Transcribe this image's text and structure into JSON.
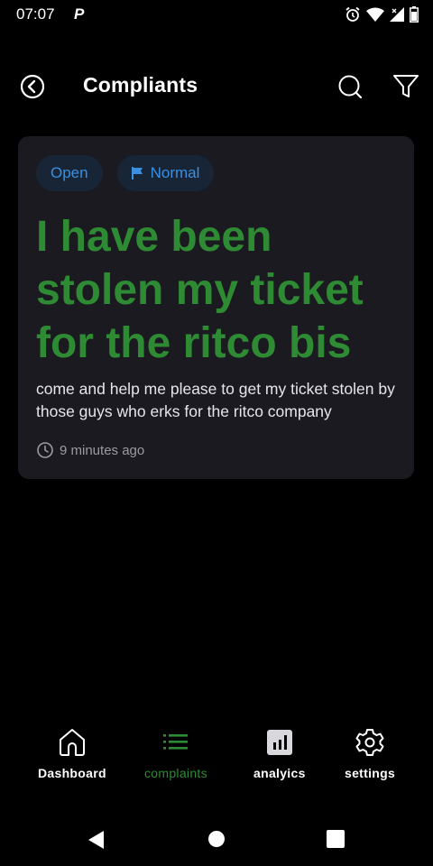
{
  "status_bar": {
    "time": "07:07",
    "app_indicator": "P",
    "icons": [
      "alarm-icon",
      "wifi-icon",
      "signal-icon",
      "battery-icon"
    ]
  },
  "app_bar": {
    "title": "Compliants",
    "back_icon": "back-circle-icon",
    "search_icon": "search-icon",
    "filter_icon": "filter-icon"
  },
  "complaint": {
    "status": "Open",
    "priority": "Normal",
    "priority_icon": "flag-icon",
    "title": "I have been stolen my ticket for the ritco bis",
    "description": "come and help me please to get my ticket stolen by those guys who erks for the ritco company",
    "time_ago": "9 minutes ago"
  },
  "bottom_nav": {
    "items": [
      {
        "label": "Dashboard",
        "icon": "home-icon",
        "active": false
      },
      {
        "label": "complaints",
        "icon": "list-icon",
        "active": true
      },
      {
        "label": "analyics",
        "icon": "analytics-icon",
        "active": false
      },
      {
        "label": "settings",
        "icon": "gear-icon",
        "active": false
      }
    ]
  },
  "colors": {
    "background": "#000000",
    "card": "#1b1a20",
    "accent_green": "#2e8b34",
    "chip_background": "#172536",
    "chip_text": "#3b8fe0"
  }
}
